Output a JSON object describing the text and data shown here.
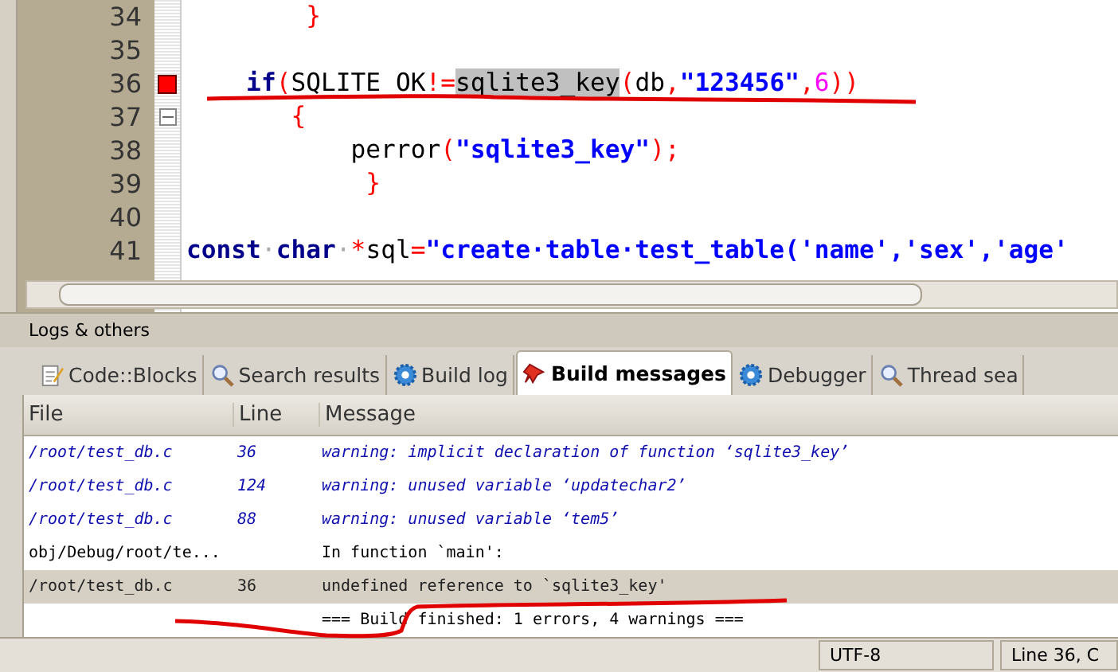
{
  "editor": {
    "lines": [
      {
        "number": "34",
        "error": false,
        "fold": false,
        "tokens": [
          {
            "kind": "op",
            "text": "        }"
          }
        ]
      },
      {
        "number": "35",
        "error": false,
        "fold": false
      },
      {
        "number": "36",
        "error": true,
        "fold": false,
        "tokens": [
          {
            "kind": "keyword",
            "text": "    if"
          },
          {
            "kind": "op",
            "text": "("
          },
          {
            "kind": "plain",
            "text": "SQLITE_OK"
          },
          {
            "kind": "op",
            "text": "!="
          },
          {
            "kind": "selected",
            "text": "sqlite3_key"
          },
          {
            "kind": "op",
            "text": "("
          },
          {
            "kind": "plain",
            "text": "db"
          },
          {
            "kind": "op",
            "text": ","
          },
          {
            "kind": "string",
            "text": "\"123456\""
          },
          {
            "kind": "op",
            "text": ","
          },
          {
            "kind": "number",
            "text": "6"
          },
          {
            "kind": "op",
            "text": "))"
          }
        ]
      },
      {
        "number": "37",
        "error": false,
        "fold": true,
        "tokens": [
          {
            "kind": "op",
            "text": "       {"
          }
        ]
      },
      {
        "number": "38",
        "error": false,
        "fold": false,
        "tokens": [
          {
            "kind": "plain",
            "text": "           perror"
          },
          {
            "kind": "op",
            "text": "("
          },
          {
            "kind": "string",
            "text": "\"sqlite3_key\""
          },
          {
            "kind": "op",
            "text": ");"
          }
        ]
      },
      {
        "number": "39",
        "error": false,
        "fold": false,
        "tokens": [
          {
            "kind": "op",
            "text": "            }"
          }
        ]
      },
      {
        "number": "40",
        "error": false,
        "fold": false
      },
      {
        "number": "41",
        "error": false,
        "fold": false,
        "tokens": [
          {
            "kind": "keyword",
            "text": "const"
          },
          {
            "kind": "space",
            "text": "·"
          },
          {
            "kind": "keyword",
            "text": "char"
          },
          {
            "kind": "space",
            "text": "·"
          },
          {
            "kind": "op",
            "text": "*"
          },
          {
            "kind": "plain",
            "text": "sql"
          },
          {
            "kind": "op",
            "text": "="
          },
          {
            "kind": "string",
            "text": "\"create·table·test_table('name','sex','age'"
          }
        ]
      }
    ]
  },
  "panel": {
    "title": "Logs & others",
    "tabs": [
      {
        "label": "Code::Blocks",
        "kind": "editor",
        "selected": false
      },
      {
        "label": "Search results",
        "kind": "search",
        "selected": false
      },
      {
        "label": "Build log",
        "kind": "log",
        "selected": false
      },
      {
        "label": "Build messages",
        "kind": "messages",
        "selected": true
      },
      {
        "label": "Debugger",
        "kind": "debugger",
        "selected": false
      },
      {
        "label": "Thread sea",
        "kind": "search",
        "selected": false
      }
    ],
    "columns": [
      "File",
      "Line",
      "Message"
    ],
    "rows": [
      {
        "kind": "warning",
        "selected": false,
        "file": "/root/test_db.c",
        "line": "36",
        "message": "warning: implicit declaration of function ‘sqlite3_key’"
      },
      {
        "kind": "warning",
        "selected": false,
        "file": "/root/test_db.c",
        "line": "124",
        "message": "warning: unused variable ‘updatechar2’"
      },
      {
        "kind": "warning",
        "selected": false,
        "file": "/root/test_db.c",
        "line": "88",
        "message": "warning: unused variable ‘tem5’"
      },
      {
        "kind": "info",
        "selected": false,
        "file": "obj/Debug/root/te...",
        "message": "In function `main':"
      },
      {
        "kind": "error",
        "selected": true,
        "file": "/root/test_db.c",
        "line": "36",
        "message": "undefined reference to `sqlite3_key'"
      },
      {
        "kind": "info",
        "selected": false,
        "message": "=== Build finished: 1 errors, 4 warnings ==="
      }
    ]
  },
  "status_bar": {
    "encoding": "UTF-8",
    "position": "Line 36, C"
  }
}
